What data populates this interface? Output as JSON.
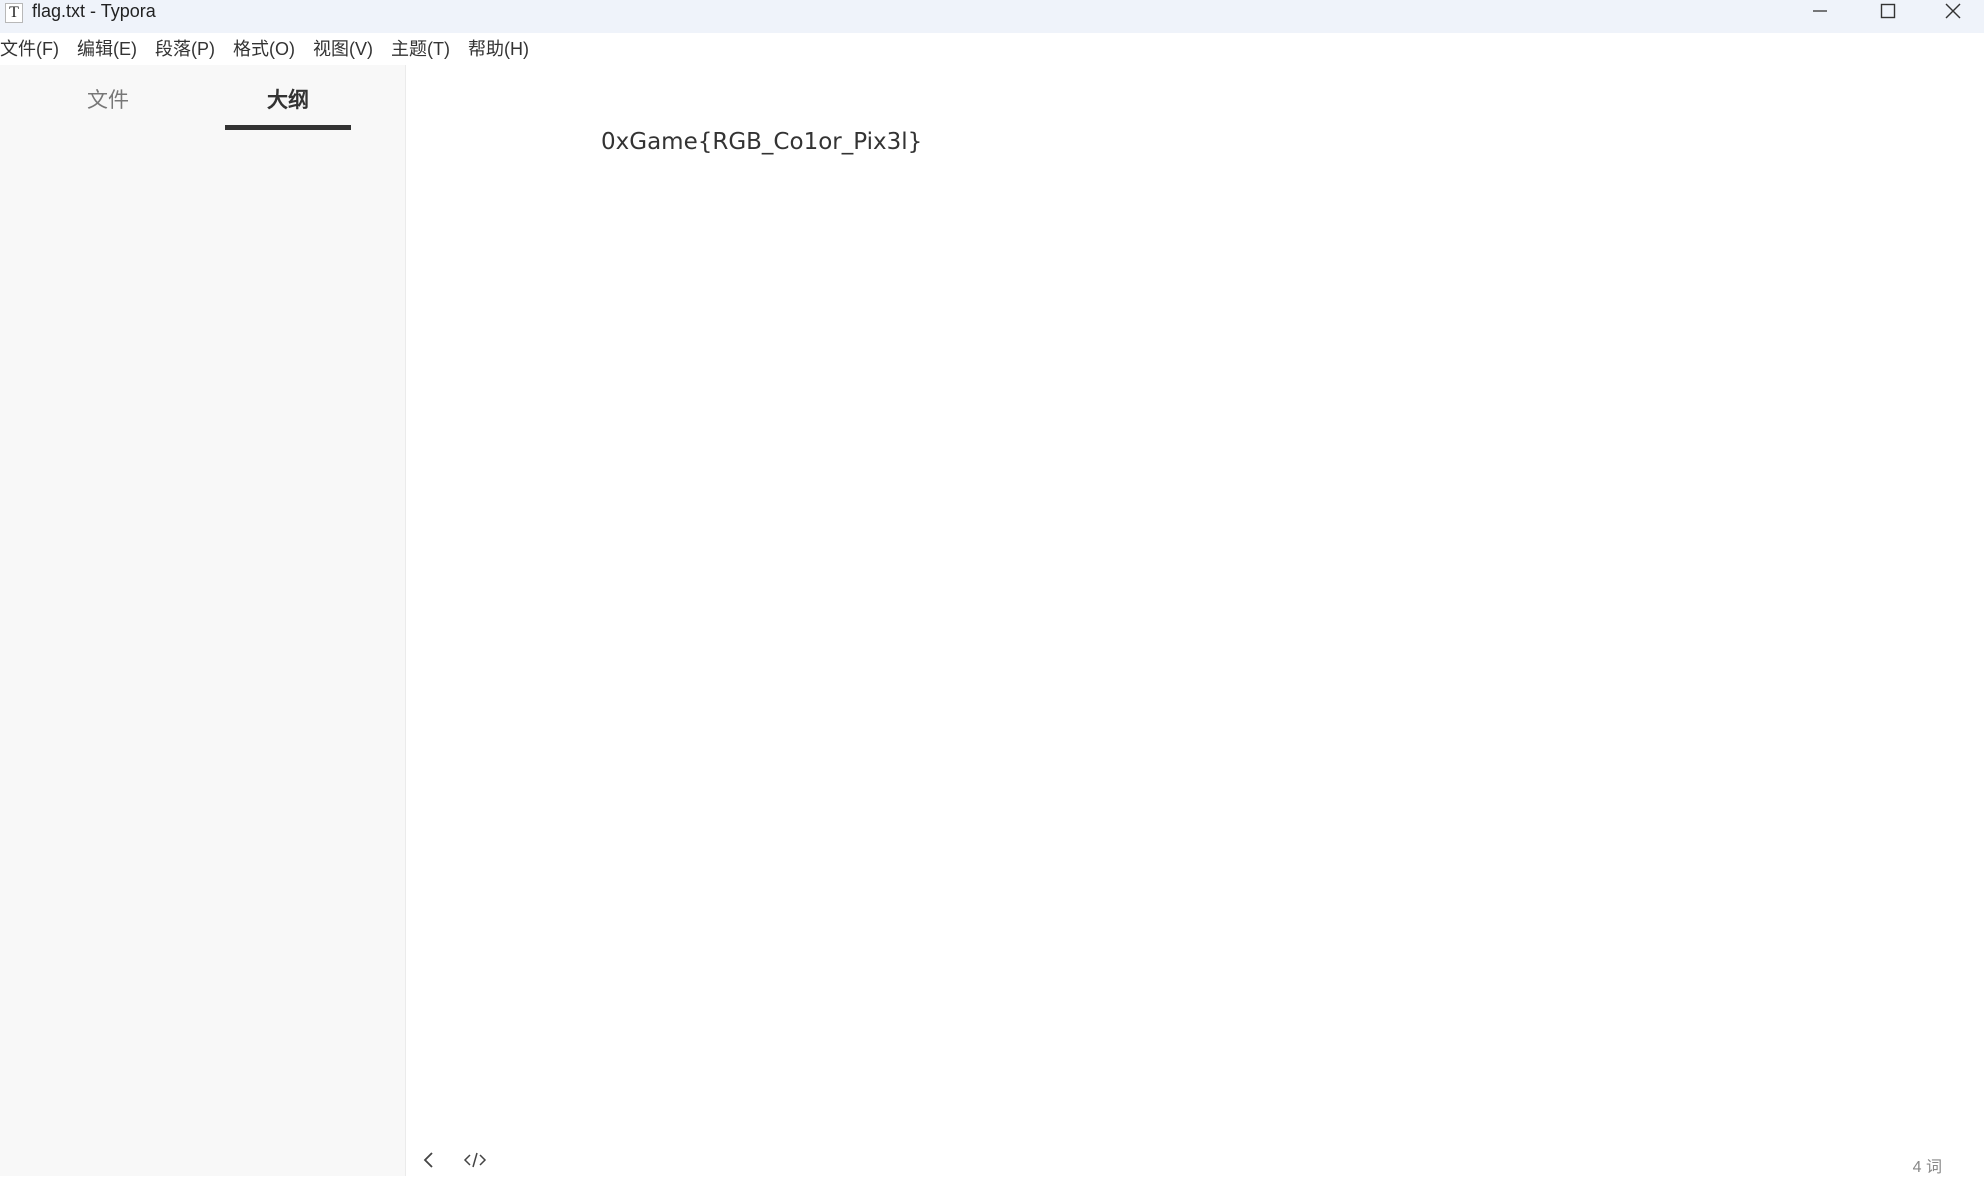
{
  "window": {
    "title": "flag.txt - Typora",
    "app_icon_letter": "T"
  },
  "menu": {
    "items": [
      "文件(F)",
      "编辑(E)",
      "段落(P)",
      "格式(O)",
      "视图(V)",
      "主题(T)",
      "帮助(H)"
    ]
  },
  "sidebar": {
    "tabs": [
      {
        "label": "文件",
        "active": false
      },
      {
        "label": "大纲",
        "active": true
      }
    ]
  },
  "document": {
    "content": "0xGame{RGB_Co1or_Pix3l}"
  },
  "statusbar": {
    "word_count": "4 词",
    "icons": [
      "chevron-left-icon",
      "source-code-icon"
    ]
  }
}
